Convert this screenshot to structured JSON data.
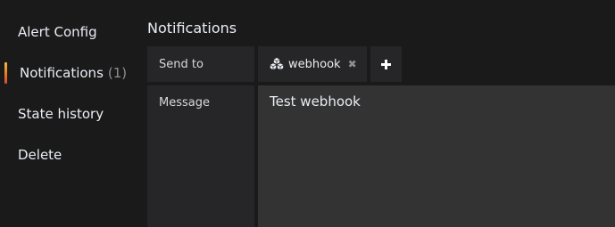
{
  "sidebar": {
    "items": [
      {
        "label": "Alert Config"
      },
      {
        "label": "Notifications",
        "count": "(1)"
      },
      {
        "label": "State history"
      },
      {
        "label": "Delete"
      }
    ]
  },
  "notifications": {
    "title": "Notifications",
    "send_to_label": "Send to",
    "message_label": "Message",
    "tags": [
      {
        "label": "webhook",
        "icon": "cubes-icon",
        "remove_icon": "close-icon"
      }
    ],
    "add_icon": "plus-icon",
    "message_value": "Test webhook"
  },
  "colors": {
    "background": "#1a1a1b",
    "panel": "#262628",
    "input": "#333333",
    "active_accent": "#eb7b18"
  }
}
